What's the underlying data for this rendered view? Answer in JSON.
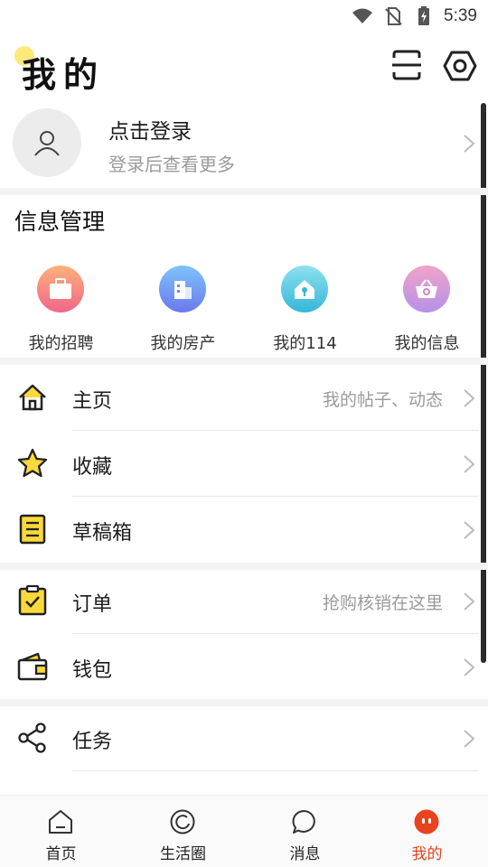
{
  "status_bar": {
    "time": "5:39"
  },
  "header": {
    "title": "我的"
  },
  "profile": {
    "login_text": "点击登录",
    "login_hint": "登录后查看更多"
  },
  "info_section": {
    "title": "信息管理",
    "items": [
      {
        "label": "我的招聘",
        "icon": "briefcase-icon",
        "color": "#f26a8a"
      },
      {
        "label": "我的房产",
        "icon": "building-icon",
        "color": "#5b8ff0"
      },
      {
        "label": "我的114",
        "icon": "house-key-icon",
        "color": "#37c2d8"
      },
      {
        "label": "我的信息",
        "icon": "basket-icon",
        "color": "#e57ab2"
      }
    ]
  },
  "menu_group1": [
    {
      "label": "主页",
      "hint": "我的帖子、动态",
      "icon": "home-icon"
    },
    {
      "label": "收藏",
      "hint": "",
      "icon": "star-icon"
    },
    {
      "label": "草稿箱",
      "hint": "",
      "icon": "notepad-icon"
    }
  ],
  "menu_group2": [
    {
      "label": "订单",
      "hint": "抢购核销在这里",
      "icon": "clipboard-check-icon"
    },
    {
      "label": "钱包",
      "hint": "",
      "icon": "wallet-icon"
    }
  ],
  "menu_group3": [
    {
      "label": "任务",
      "hint": "",
      "icon": "share-icon"
    }
  ],
  "bottom_nav": [
    {
      "label": "首页",
      "icon": "home-outline-icon",
      "active": false
    },
    {
      "label": "生活圈",
      "icon": "life-circle-icon",
      "active": false
    },
    {
      "label": "消息",
      "icon": "message-icon",
      "active": false
    },
    {
      "label": "我的",
      "icon": "profile-face-icon",
      "active": true
    }
  ],
  "colors": {
    "accent": "#e8421e",
    "icon_yellow": "#fbd93a"
  }
}
